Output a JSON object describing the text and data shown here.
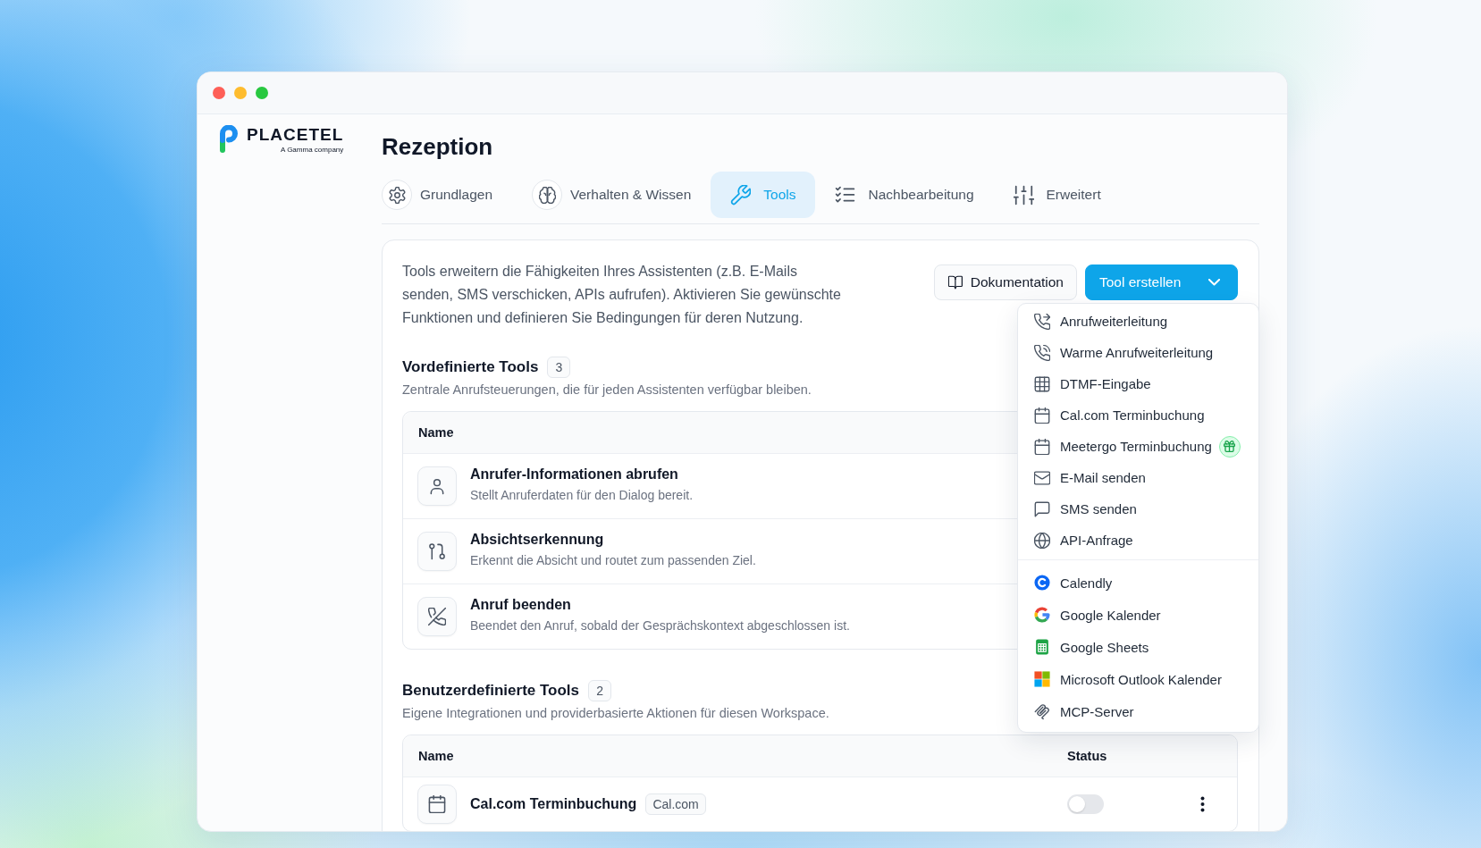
{
  "brand": {
    "name": "PLACETEL",
    "tagline": "A Gamma company"
  },
  "page_title": "Rezeption",
  "tabs": [
    {
      "label": "Grundlagen",
      "selected": false
    },
    {
      "label": "Verhalten & Wissen",
      "selected": false
    },
    {
      "label": "Tools",
      "selected": true
    },
    {
      "label": "Nachbearbeitung",
      "selected": false
    },
    {
      "label": "Erweitert",
      "selected": false
    }
  ],
  "intro": "Tools erweitern die Fähigkeiten Ihres Assistenten (z.B. E-Mails senden, SMS verschicken, APIs aufrufen). Aktivieren Sie gewünschte Funktionen und definieren Sie Bedingungen für deren Nutzung.",
  "documentation_button": {
    "label": "Dokumentation"
  },
  "create_button": {
    "label": "Tool erstellen",
    "expanded": true
  },
  "create_menu": {
    "groups": [
      {
        "items": [
          {
            "label": "Anrufweiterleitung",
            "gift_badge": false
          },
          {
            "label": "Warme Anrufweiterleitung",
            "gift_badge": false
          },
          {
            "label": "DTMF-Eingabe",
            "gift_badge": false
          },
          {
            "label": "Cal.com Terminbuchung",
            "gift_badge": false
          },
          {
            "label": "Meetergo Terminbuchung",
            "gift_badge": true
          },
          {
            "label": "E-Mail senden",
            "gift_badge": false
          },
          {
            "label": "SMS senden",
            "gift_badge": false
          },
          {
            "label": "API-Anfrage",
            "gift_badge": false
          }
        ]
      },
      {
        "items": [
          {
            "label": "Calendly",
            "gift_badge": false
          },
          {
            "label": "Google Kalender",
            "gift_badge": false
          },
          {
            "label": "Google Sheets",
            "gift_badge": false
          },
          {
            "label": "Microsoft Outlook Kalender",
            "gift_badge": false
          },
          {
            "label": "MCP-Server",
            "gift_badge": false
          }
        ]
      }
    ]
  },
  "sections": [
    {
      "title": "Vordefinierte Tools",
      "count": "3",
      "subtitle": "Zentrale Anrufsteuerungen, die für jeden Assistenten verfügbar bleiben.",
      "columns": [
        "Name"
      ],
      "rows": [
        {
          "kind": "builtin",
          "name": "Anrufer-Informationen abrufen",
          "description": "Stellt Anruferdaten für den Dialog bereit."
        },
        {
          "kind": "builtin",
          "name": "Absichtserkennung",
          "description": "Erkennt die Absicht und routet zum passenden Ziel."
        },
        {
          "kind": "builtin",
          "name": "Anruf beenden",
          "description": "Beendet den Anruf, sobald der Gesprächskontext abgeschlossen ist."
        }
      ]
    },
    {
      "title": "Benutzerdefinierte Tools",
      "count": "2",
      "subtitle": "Eigene Integrationen und providerbasierte Aktionen für diesen Workspace.",
      "columns": [
        "Name",
        "Status"
      ],
      "rows": [
        {
          "kind": "custom",
          "name": "Cal.com Terminbuchung",
          "provider": "Cal.com",
          "enabled": false
        }
      ]
    }
  ]
}
